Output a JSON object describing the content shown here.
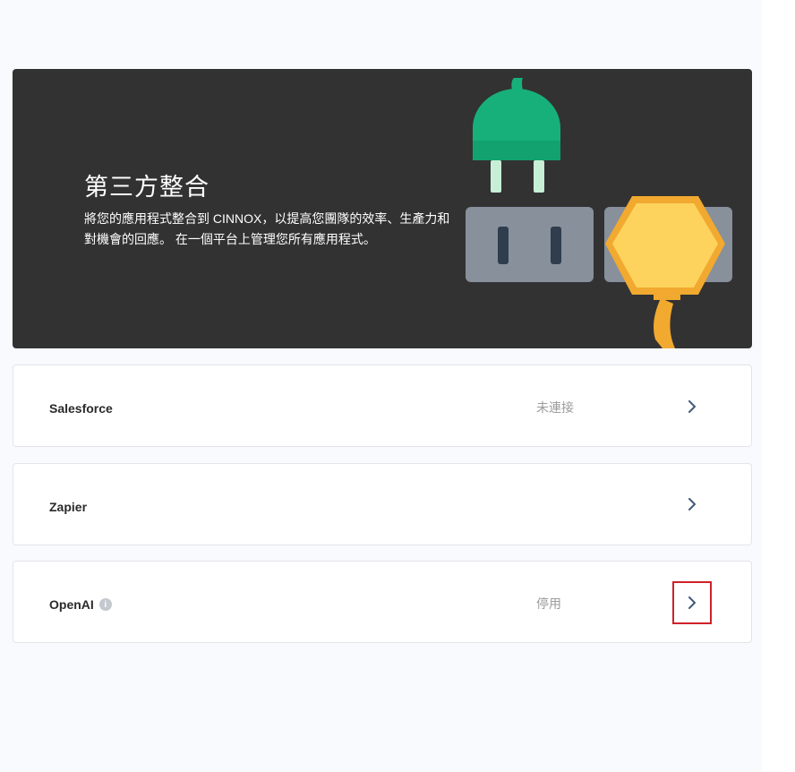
{
  "banner": {
    "title": "第三方整合",
    "description": "將您的應用程式整合到 CINNOX，以提高您團隊的效率、生產力和對機會的回應。 在一個平台上管理您所有應用程式。"
  },
  "integrations": [
    {
      "name": "Salesforce",
      "status": "未連接",
      "has_info_icon": false,
      "arrow_icon": "chevron-right-icon"
    },
    {
      "name": "Zapier",
      "status": "",
      "has_info_icon": false,
      "arrow_icon": "chevron-right-icon"
    },
    {
      "name": "OpenAI",
      "status": "停用",
      "has_info_icon": true,
      "info_icon": "info-icon",
      "arrow_icon": "chevron-right-icon"
    }
  ],
  "colors": {
    "banner_bg": "#323232",
    "plug_green": "#17b07b",
    "plug_yellow": "#fdd35d",
    "socket_gray": "#87909b",
    "highlight_red": "#d0202a"
  }
}
